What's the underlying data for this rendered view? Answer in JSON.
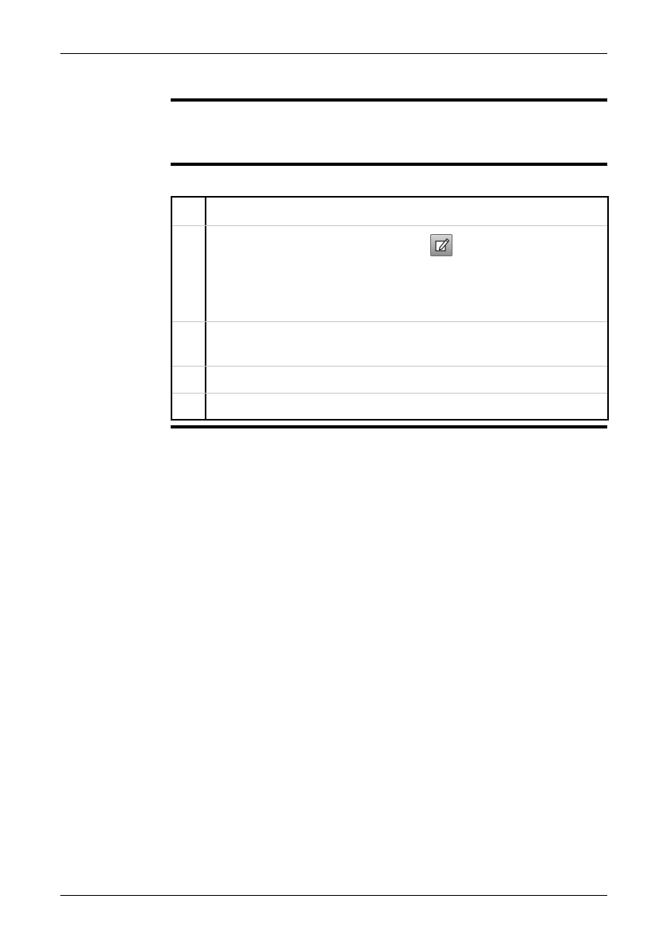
{
  "page": {
    "header_text": "",
    "footer_text": ""
  },
  "section": {
    "heading": ""
  },
  "procedure": {
    "steps": [
      {
        "number": "",
        "text": ""
      },
      {
        "number": "",
        "text": "",
        "icon": "edit-pencil-icon"
      },
      {
        "number": "",
        "text": ""
      },
      {
        "number": "",
        "text": ""
      },
      {
        "number": "",
        "text": ""
      }
    ]
  },
  "colors": {
    "rule": "#000000",
    "row_separator": "#c8c8c8",
    "icon_fill_top": "#d6d6d6",
    "icon_fill_bottom": "#8e8e8e"
  }
}
